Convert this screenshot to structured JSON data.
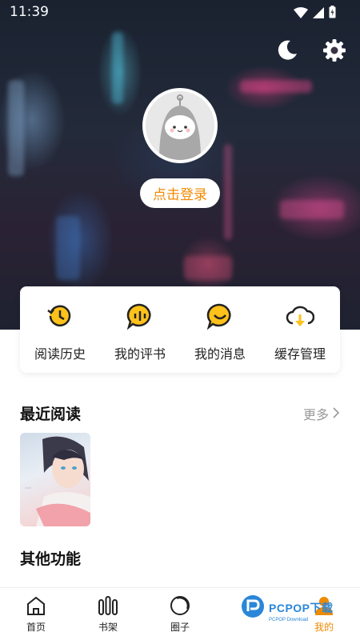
{
  "status_bar": {
    "time": "11:39"
  },
  "header": {
    "login_label": "点击登录"
  },
  "quick_actions": [
    {
      "label": "阅读历史",
      "icon": "history-icon"
    },
    {
      "label": "我的评书",
      "icon": "comment-icon"
    },
    {
      "label": "我的消息",
      "icon": "message-icon"
    },
    {
      "label": "缓存管理",
      "icon": "cloud-download-icon"
    }
  ],
  "recent": {
    "title": "最近阅读",
    "more_label": "更多"
  },
  "other": {
    "title": "其他功能"
  },
  "nav": [
    {
      "label": "首页",
      "icon": "home-icon"
    },
    {
      "label": "书架",
      "icon": "bookshelf-icon"
    },
    {
      "label": "圈子",
      "icon": "circle-icon"
    },
    {
      "label": "",
      "icon": "discover-icon"
    },
    {
      "label": "我的",
      "icon": "user-icon",
      "active": true
    }
  ],
  "watermark": {
    "text": "PCPOP下载",
    "sub": "PCPOP Download"
  },
  "colors": {
    "accent": "#f08a00",
    "text": "#222222",
    "muted": "#999999"
  }
}
